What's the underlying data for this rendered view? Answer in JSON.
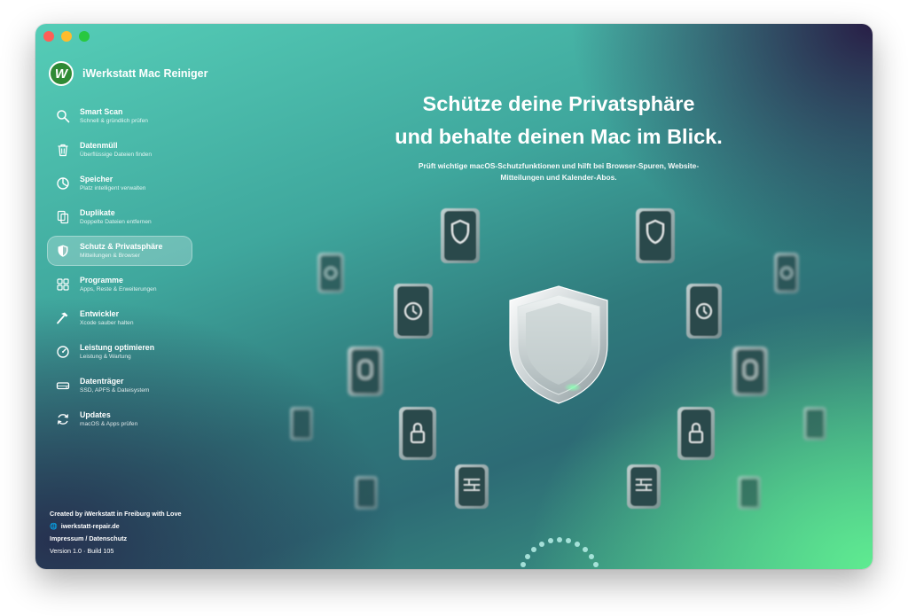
{
  "app": {
    "name": "iWerkstatt Mac Reiniger",
    "logo_letter": "W"
  },
  "sidebar": {
    "items": [
      {
        "label": "Smart Scan",
        "sub": "Schnell & gründlich prüfen",
        "icon": "search-icon"
      },
      {
        "label": "Datenmüll",
        "sub": "Überflüssige Dateien finden",
        "icon": "trash-icon"
      },
      {
        "label": "Speicher",
        "sub": "Platz intelligent verwalten",
        "icon": "pie-chart-icon"
      },
      {
        "label": "Duplikate",
        "sub": "Doppelte Dateien entfernen",
        "icon": "duplicate-files-icon"
      },
      {
        "label": "Schutz & Privatsphäre",
        "sub": "Mitteilungen & Browser",
        "icon": "shield-icon",
        "active": true
      },
      {
        "label": "Programme",
        "sub": "Apps, Reste & Erweiterungen",
        "icon": "grid-icon"
      },
      {
        "label": "Entwickler",
        "sub": "Xcode sauber halten",
        "icon": "hammer-icon"
      },
      {
        "label": "Leistung optimieren",
        "sub": "Leistung & Wartung",
        "icon": "speedometer-icon"
      },
      {
        "label": "Datenträger",
        "sub": "SSD, APFS & Dateisystem",
        "icon": "drive-icon"
      },
      {
        "label": "Updates",
        "sub": "macOS & Apps prüfen",
        "icon": "refresh-icon"
      }
    ]
  },
  "footer": {
    "credit": "Created by iWerkstatt in Freiburg with Love",
    "website": "iwerkstatt-repair.de",
    "legal": "Impressum / Datenschutz",
    "version": "Version 1.0 · Build 105"
  },
  "hero": {
    "title_line1": "Schütze deine Privatsphäre",
    "title_line2": "und behalte deinen Mac im Blick.",
    "desc_line1": "Prüft wichtige macOS-Schutzfunktionen und hilft bei Browser-Spuren, Website-",
    "desc_line2": "Mitteilungen und Kalender-Abos."
  },
  "colors": {
    "accent_green": "#5fe991",
    "teal": "#3fa79d",
    "navy": "#262e4e",
    "active_bg": "rgba(255,255,255,0.24)"
  }
}
